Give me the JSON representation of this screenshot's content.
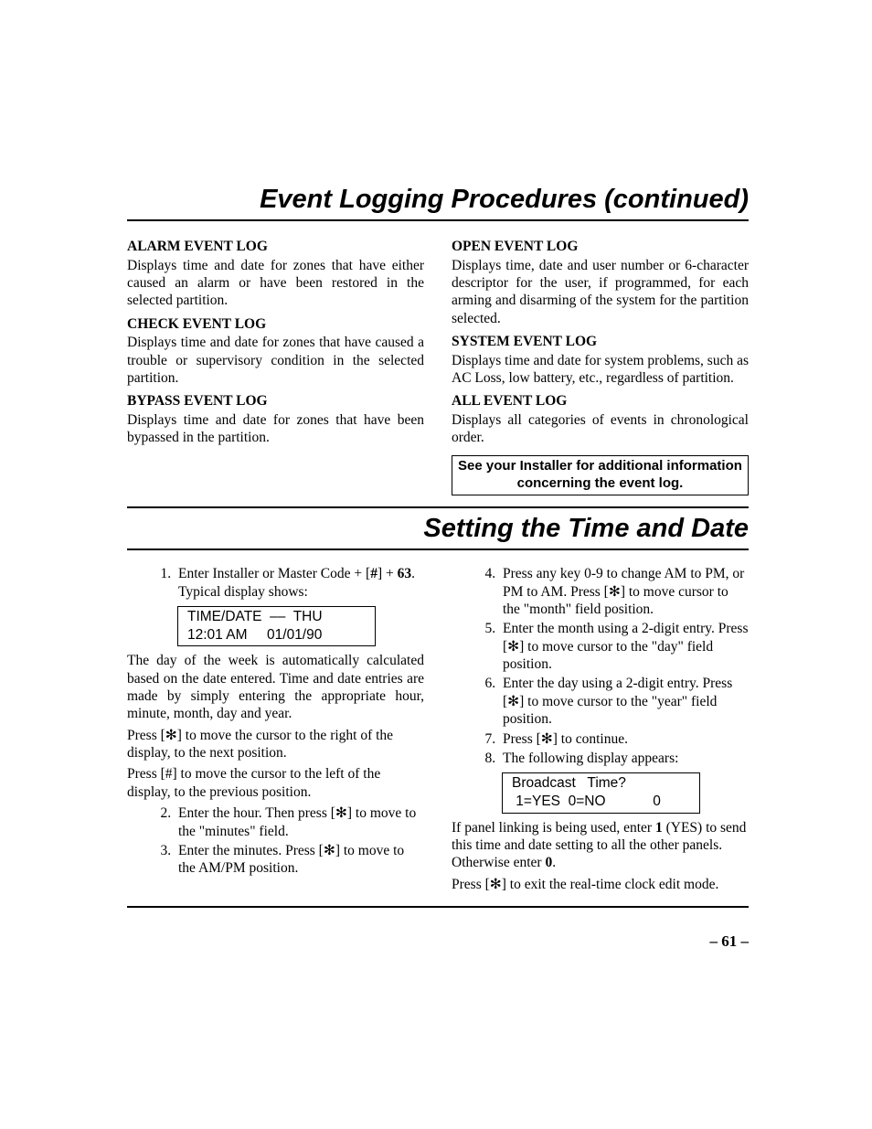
{
  "section1": {
    "title": "Event Logging Procedures (continued)",
    "left": {
      "h1": "ALARM EVENT LOG",
      "p1": "Displays time and date for zones that have either caused an alarm or have been restored in the selected partition.",
      "h2": "CHECK EVENT LOG",
      "p2": "Displays time and date for zones that have caused a trouble or supervisory condition in the selected partition.",
      "h3": "BYPASS EVENT LOG",
      "p3": "Displays time and date for zones that have been bypassed in the partition."
    },
    "right": {
      "h1": "OPEN EVENT LOG",
      "p1": "Displays time, date and user number or 6-character descriptor for the user, if programmed, for each arming and disarming of the system for the partition selected.",
      "h2": "SYSTEM EVENT LOG",
      "p2": "Displays time and date for system problems, such as AC Loss, low battery, etc., regardless of partition.",
      "h3": "ALL EVENT LOG",
      "p3": "Displays all categories of events in chronological order.",
      "note": "See your Installer for additional information concerning the event log."
    }
  },
  "section2": {
    "title": "Setting the Time and Date",
    "left": {
      "li1a": "Enter Installer or Master Code + [",
      "li1hash": "#",
      "li1b": "] + ",
      "li1code": "63",
      "li1c": ".  Typical display shows:",
      "disp_line1": "TIME/DATE  ––  THU",
      "disp_line2": "12:01 AM     01/01/90",
      "p1": "The day of the week is automatically calculated based on the date entered. Time and date entries are made by simply entering the appropriate hour, minute, month, day and year.",
      "p2": "Press [✻] to move the cursor to the right of the display, to the next position.",
      "p3": "Press [#] to move the cursor to the left of the display, to the previous position.",
      "li2": "Enter the hour. Then press [✻] to move to the \"minutes\" field.",
      "li3": "Enter the minutes. Press [✻] to move to the AM/PM position."
    },
    "right": {
      "li4": "Press any key 0-9 to change AM to PM, or PM to AM. Press [✻] to move cursor to the \"month\" field position.",
      "li5": "Enter the month using a 2-digit entry. Press [✻] to move cursor to the \"day\" field position.",
      "li6": "Enter the day using a 2-digit entry. Press [✻] to move cursor to the \"year\" field position.",
      "li7": "Press [✻] to continue.",
      "li8": "The following display appears:",
      "disp_line1": "Broadcast   Time?",
      "disp_line2": " 1=YES  0=NO            0",
      "p1a": "If panel linking is being used, enter ",
      "p1b1": "1",
      "p1c": " (YES) to send this time and date setting to all the other panels. Otherwise enter ",
      "p1b0": "0",
      "p1d": ".",
      "p2": "Press [✻] to exit the real-time clock edit mode."
    }
  },
  "page_number": "– 61 –"
}
